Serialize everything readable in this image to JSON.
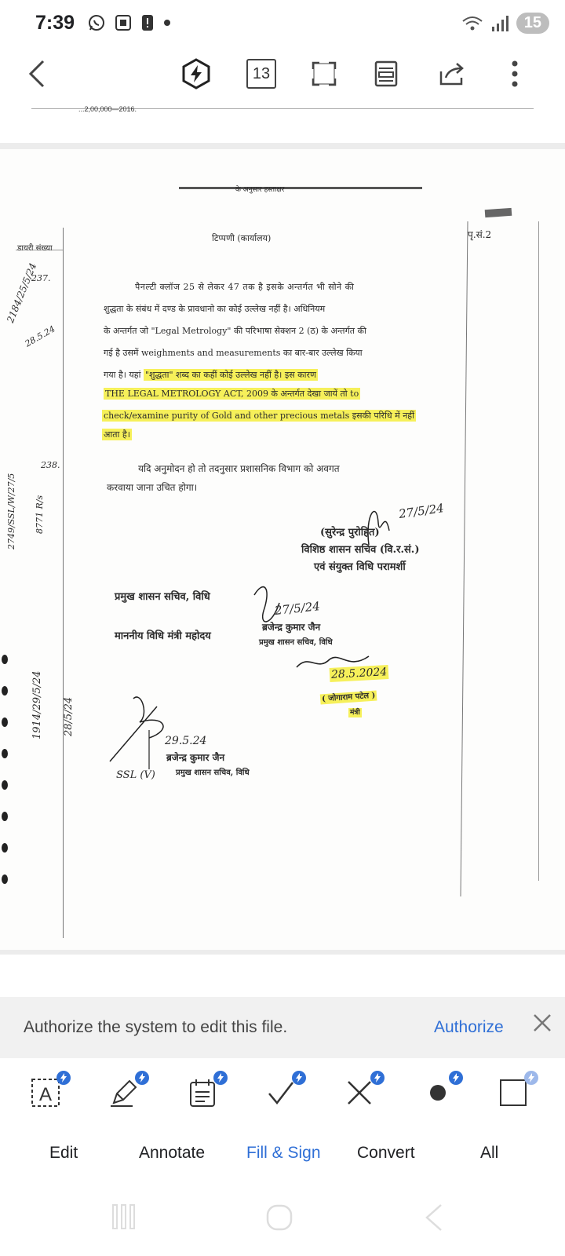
{
  "status_bar": {
    "time": "7:39",
    "battery": "15"
  },
  "toolbar": {
    "page_number": "13"
  },
  "document": {
    "top_cut_text": "...2,00,000—2016.",
    "header_text": "के अनुसार हस्ताक्षर",
    "margin_header": "डायरी संख्या",
    "page_ref": "पृ.सं.2",
    "title": "टिप्पणी (कार्यालय)",
    "para1_line1": "पैनल्टी क्लॉज 25 से लेकर 47 तक है इसके अन्तर्गत भी सोने की",
    "para1_line2": "शुद्धता के संबंध में दण्ड के प्रावधानो का कोई उल्लेख नहीं है। अधिनियम",
    "para1_line3": "के अन्तर्गत जो \"Legal Metrology\" की परिभाषा सेक्शन 2 (ठ) के अन्तर्गत की",
    "para1_line4": "गई है उसमें weighments and measurements का बार-बार उल्लेख किया",
    "para1_line5_plain": "गया है। यहां ",
    "para1_line5_hl": "\"शुद्धता\" शब्द का कहीं कोई उल्लेख नहीं है। इस कारण",
    "para1_line6_hl": "THE LEGAL METROLOGY ACT, 2009 के अन्तर्गत देखा जायें तो to",
    "para1_line7_hl": "check/examine purity of Gold and other precious metals इसकी परिधि में नहीं",
    "para1_line8_hl": "आता है।",
    "para2_line1": "यदि अनुमोदन हो तो तदनुसार प्रशासनिक विभाग को अवगत",
    "para2_line2": "करवाया जाना उचित होगा।",
    "sig1_name": "(सुरेन्द्र पुरोहित)",
    "sig1_title1": "विशिष्ठ शासन सचिव (वि.र.सं.)",
    "sig1_title2": "एवं संयुक्त विधि परामर्शी",
    "sig1_date": "27/5/24",
    "addressee1": "प्रमुख शासन सचिव, विधि",
    "addressee2": "माननीय विधि मंत्री महोदय",
    "sig2_date": "27/5/24",
    "sig2_name": "ब्रजेन्द्र कुमार जैन",
    "sig2_title": "प्रमुख शासन सचिव, विधि",
    "minister_date": "28.5.2024",
    "minister_name": "( जोगाराम पटेल )",
    "minister_title": "मंत्री",
    "sig3_date": "29.5.24",
    "sig3_name": "ब्रजेन्द्र कुमार जैन",
    "sig3_title": "प्रमुख शासन सचिव, विधि",
    "ssl_note": "SSL (V)",
    "margin_notes": [
      "237.",
      "2184/25/5/24",
      "28.5.24",
      "238.",
      "2749/SSL/W/27/5",
      "8771 R/s",
      "1914/29/5/24",
      "28/5/24"
    ]
  },
  "auth_bar": {
    "message": "Authorize the system to edit this file.",
    "action_label": "Authorize"
  },
  "tabs": [
    {
      "label": "Edit"
    },
    {
      "label": "Annotate"
    },
    {
      "label": "Fill & Sign"
    },
    {
      "label": "Convert"
    },
    {
      "label": "All"
    }
  ],
  "colors": {
    "accent": "#2f6fd6",
    "highlight": "#f6f05a"
  }
}
